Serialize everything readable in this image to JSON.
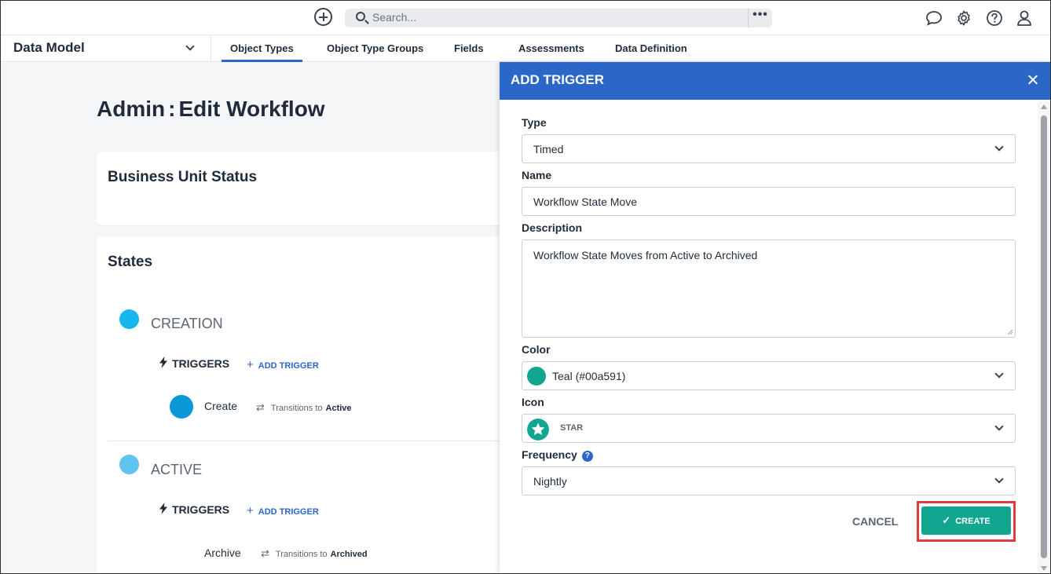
{
  "topbar": {
    "search_placeholder": "Search...",
    "more_label": "•••",
    "icons": [
      "add-icon",
      "search-icon",
      "chat-icon",
      "gear-icon",
      "help-icon",
      "user-icon"
    ]
  },
  "subnav": {
    "app_name": "Data Model",
    "tabs": [
      {
        "label": "Object Types",
        "active": true
      },
      {
        "label": "Object Type Groups",
        "active": false
      },
      {
        "label": "Fields",
        "active": false
      },
      {
        "label": "Assessments",
        "active": false
      },
      {
        "label": "Data Definition",
        "active": false
      }
    ]
  },
  "page": {
    "title_prefix": "Admin",
    "title_sep": ":",
    "title": "Edit Workflow",
    "workflow_name": "Business Unit Status",
    "states_heading": "States",
    "states": [
      {
        "name": "CREATION",
        "color": "#14b7ee",
        "triggers_label": "TRIGGERS",
        "add_trigger_label": "ADD TRIGGER",
        "triggers": [
          {
            "name": "Create",
            "dot_color": "#0a98d6",
            "transitions_label": "Transitions to",
            "target": "Active"
          }
        ]
      },
      {
        "name": "ACTIVE",
        "color": "#5fc4ee",
        "triggers_label": "TRIGGERS",
        "add_trigger_label": "ADD TRIGGER",
        "triggers": [
          {
            "name": "Archive",
            "transitions_label": "Transitions to",
            "target": "Archived"
          }
        ]
      }
    ]
  },
  "panel": {
    "title": "ADD TRIGGER",
    "fields": {
      "type": {
        "label": "Type",
        "value": "Timed"
      },
      "name": {
        "label": "Name",
        "value": "Workflow State Move"
      },
      "description": {
        "label": "Description",
        "value": "Workflow State Moves from Active to Archived"
      },
      "color": {
        "label": "Color",
        "value": "Teal (#00a591)",
        "swatch": "#12a58f"
      },
      "icon": {
        "label": "Icon",
        "value": "STAR",
        "icon_name": "star-icon"
      },
      "frequency": {
        "label": "Frequency",
        "value": "Nightly",
        "help": "?"
      }
    },
    "cancel_label": "CANCEL",
    "create_label": "CREATE"
  },
  "colors": {
    "accent": "#2a67c7",
    "create_button": "#12a58f",
    "highlight_outline": "#e03c3c"
  }
}
